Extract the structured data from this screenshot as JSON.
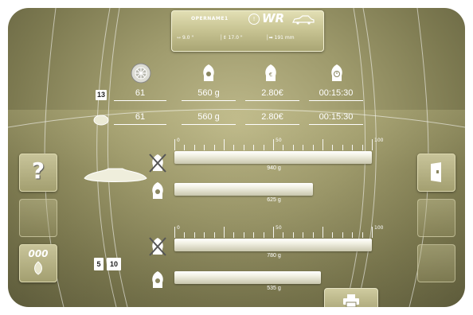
{
  "header": {
    "operator_name": "OPERNAME1",
    "mode": "WR",
    "width": "9.0 \"",
    "diameter": "17.0 \"",
    "distance": "191 mm"
  },
  "rim_label": "13",
  "summary_rows": [
    {
      "count": "61",
      "weight": "560 g",
      "cost": "2.80€",
      "time": "00:15:30"
    },
    {
      "count": "61",
      "weight": "560 g",
      "cost": "2.80€",
      "time": "00:15:30"
    }
  ],
  "groups": [
    {
      "scale": [
        "0",
        "50",
        "100"
      ],
      "bars": [
        {
          "label": "940 g",
          "fill": 1.0
        },
        {
          "label": "625 g",
          "fill": 0.7
        }
      ]
    },
    {
      "scale": [
        "0",
        "50",
        "100"
      ],
      "bars": [
        {
          "label": "780 g",
          "fill": 1.0
        },
        {
          "label": "535 g",
          "fill": 0.74
        }
      ]
    }
  ],
  "counters": [
    "5",
    "10"
  ],
  "left_buttons": {
    "help": "?",
    "counter": "000"
  },
  "colors": {
    "accent": "#a29e6e",
    "bar": "#f4f3e6",
    "text": "#ffffff"
  }
}
